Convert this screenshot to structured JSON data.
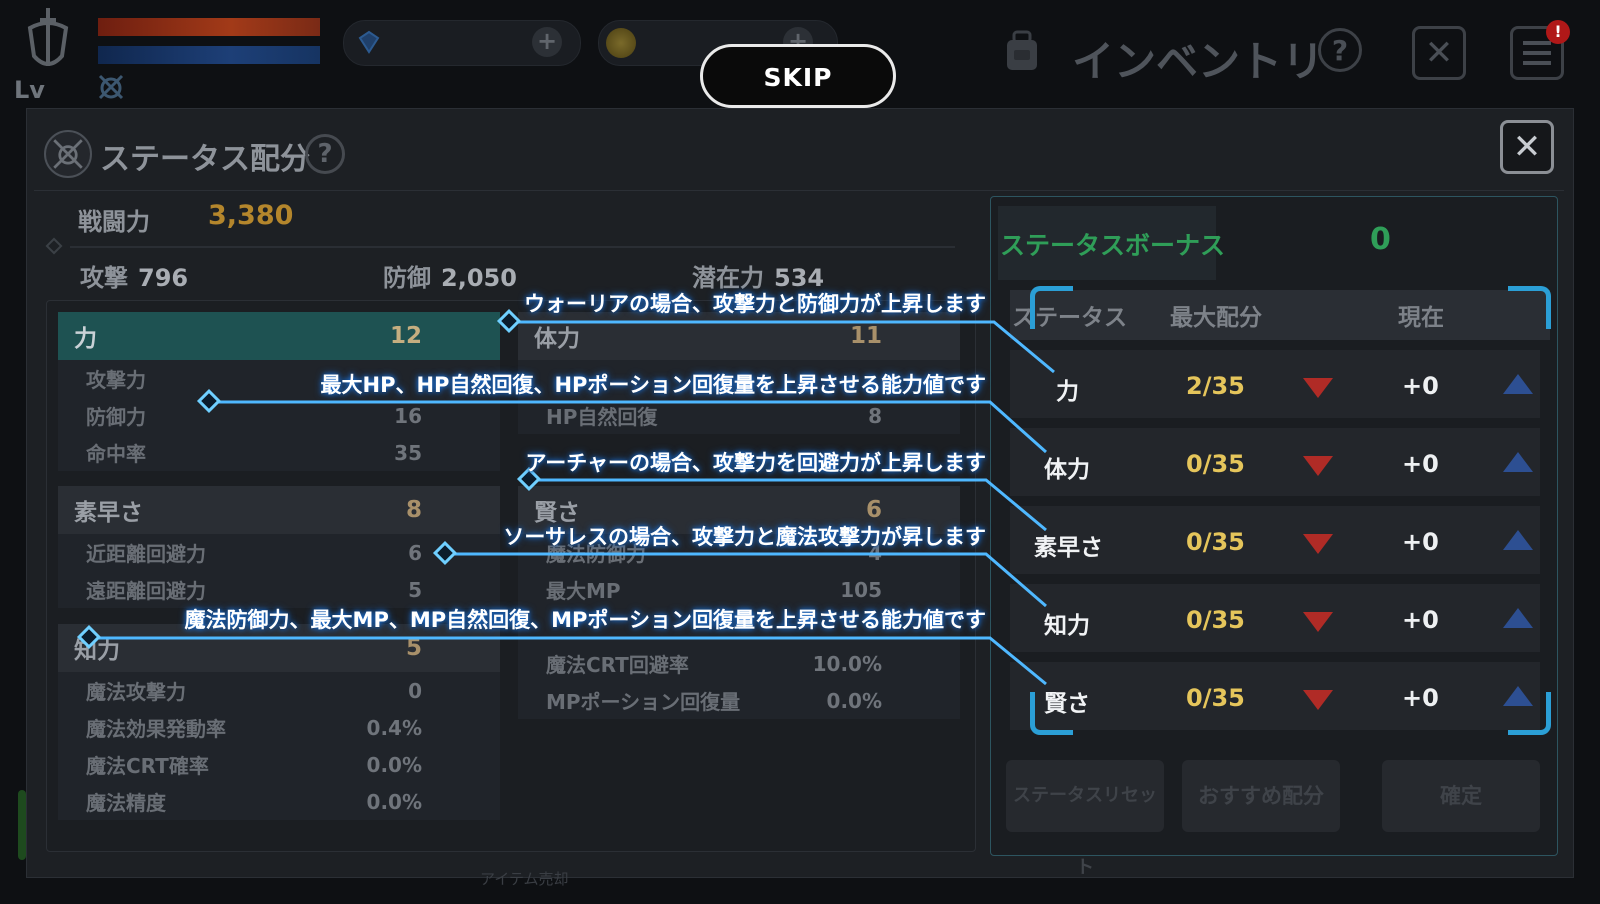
{
  "topbar": {
    "lv_label": "Lv",
    "skip_label": "SKIP",
    "inventory_title": "インベントリ",
    "help_glyph": "?",
    "close_glyph": "✕",
    "notif_glyph": "!",
    "plus_glyph": "+"
  },
  "dialog": {
    "title": "ステータス配分",
    "help_glyph": "?",
    "close_glyph": "✕"
  },
  "combat": {
    "label": "戦闘力",
    "value": "3,380",
    "attack_label": "攻撃",
    "attack_value": "796",
    "defense_label": "防御",
    "defense_value": "2,050",
    "potential_label": "潜在力",
    "potential_value": "534"
  },
  "stat_blocks": {
    "strength": {
      "name": "力",
      "value": "12",
      "rows": [
        {
          "label": "攻撃力",
          "value": ""
        },
        {
          "label": "防御力",
          "value": "16"
        },
        {
          "label": "命中率",
          "value": "35"
        }
      ]
    },
    "agility": {
      "name": "素早さ",
      "value": "8",
      "rows": [
        {
          "label": "近距離回避力",
          "value": "6"
        },
        {
          "label": "遠距離回避力",
          "value": "5"
        }
      ]
    },
    "intelligence": {
      "name": "知力",
      "value": "5",
      "rows": [
        {
          "label": "魔法攻撃力",
          "value": "0"
        },
        {
          "label": "魔法効果発動率",
          "value": "0.4%"
        },
        {
          "label": "魔法CRT確率",
          "value": "0.0%"
        },
        {
          "label": "魔法精度",
          "value": "0.0%"
        }
      ]
    },
    "vitality": {
      "name": "体力",
      "value": "11",
      "rows": [
        {
          "label": "",
          "value": ""
        },
        {
          "label": "HP自然回復",
          "value": "8"
        }
      ]
    },
    "wisdom": {
      "name": "賢さ",
      "value": "6",
      "rows": [
        {
          "label": "魔法防御力",
          "value": "4"
        },
        {
          "label": "最大MP",
          "value": "105"
        },
        {
          "label": "",
          "value": ""
        },
        {
          "label": "魔法CRT回避率",
          "value": "10.0%"
        },
        {
          "label": "MPポーション回復量",
          "value": "0.0%"
        }
      ]
    }
  },
  "bonus": {
    "label": "ステータスボーナス",
    "value": "0",
    "col_status": "ステータス",
    "col_max": "最大配分",
    "col_current": "現在",
    "rows": [
      {
        "name": "力",
        "max": "2/35",
        "current": "+0"
      },
      {
        "name": "体力",
        "max": "0/35",
        "current": "+0"
      },
      {
        "name": "素早さ",
        "max": "0/35",
        "current": "+0"
      },
      {
        "name": "知力",
        "max": "0/35",
        "current": "+0"
      },
      {
        "name": "賢さ",
        "max": "0/35",
        "current": "+0"
      }
    ]
  },
  "buttons": {
    "reset": "ステータスリセット",
    "recommend": "おすすめ配分",
    "confirm": "確定"
  },
  "tutorial": {
    "tip_strength": "ウォーリアの場合、攻撃力と防御力が上昇します",
    "tip_vitality": "最大HP、HP自然回復、HPポーション回復量を上昇させる能力値です",
    "tip_agility": "アーチャーの場合、攻撃力を回避力が上昇します",
    "tip_intelligence": "ソーサレスの場合、攻撃力と魔法攻撃力が昇します",
    "tip_wisdom": "魔法防御力、最大MP、MP自然回復、MPポーション回復量を上昇させる能力値です"
  },
  "footer_ghost": "アイテム売却"
}
